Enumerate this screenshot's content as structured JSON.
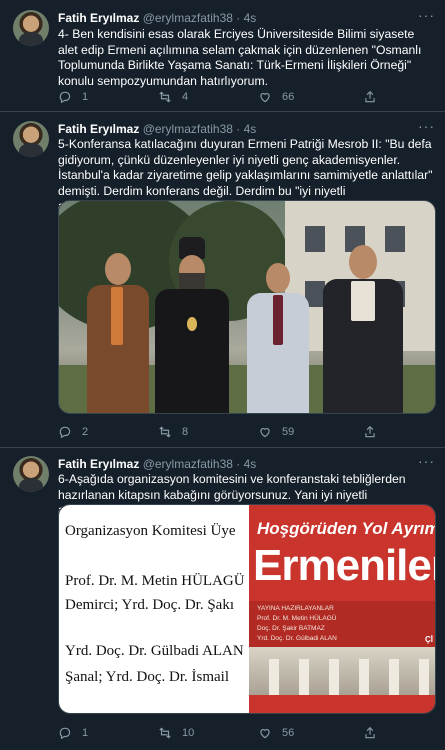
{
  "tweets": [
    {
      "name": "Fatih Eryılmaz",
      "handle": "@erylmazfatih38",
      "time": "4s",
      "text": "4- Ben kendisini esas olarak Erciyes Üniversiteside Bilimi siyasete alet edip Ermeni açılımına selam çakmak için düzenlenen \"Osmanlı Toplumunda Birlikte Yaşama Sanatı: Türk-Ermeni İlişkileri Örneği\" konulu sempozyumundan hatırlıyorum.",
      "replies": "1",
      "retweets": "4",
      "likes": "66"
    },
    {
      "name": "Fatih Eryılmaz",
      "handle": "@erylmazfatih38",
      "time": "4s",
      "text": "5-Konferansa katılacağını  duyuran Ermeni Patriği Mesrob II: \"Bu defa gidiyorum, çünkü düzenleyenler iyi niyetli genç akademisyenler. İstanbul'a kadar ziyaretime gelip yaklaşımlarını samimiyetle anlattılar\" demişti. Derdim konferans değil. Derdim bu \"iyi niyetli akademisyenler\"",
      "replies": "2",
      "retweets": "8",
      "likes": "59"
    },
    {
      "name": "Fatih Eryılmaz",
      "handle": "@erylmazfatih38",
      "time": "4s",
      "text": "6-Aşağıda organizasyon komitesini ve konferanstaki tebliğlerden hazırlanan kitapsın kabağını görüyorsunuz. Yani iyi niyetli akademisyenleri!!!",
      "replies": "1",
      "retweets": "10",
      "likes": "56",
      "collage": {
        "paper_lines": [
          "Organizasyon Komitesi Üye",
          "Prof. Dr. M. Metin HÜLAGÜ",
          "Demirci; Yrd. Doç. Dr. Şakı",
          "Yrd. Doç. Dr. Gülbadi ALAN",
          "Şanal; Yrd. Doç. Dr. İsmail"
        ],
        "book_title_1": "Hoşgörüden Yol Ayrımına",
        "book_title_2": "Ermeniler",
        "book_editors": [
          "YAYINA HAZIRLAYANLAR",
          "Prof. Dr. M. Metin HÜLAGÜ",
          "Doç. Dr. Şakir BATMAZ",
          "Yrd. Doç. Dr. Gülbadi ALAN"
        ],
        "book_publisher": "Çİ"
      }
    }
  ],
  "colors": {
    "background": "#15202b",
    "divider": "#38444d",
    "muted": "#8899a6",
    "text": "#ffffff"
  },
  "icons": [
    "reply-icon",
    "retweet-icon",
    "like-icon",
    "share-icon",
    "more-icon"
  ]
}
